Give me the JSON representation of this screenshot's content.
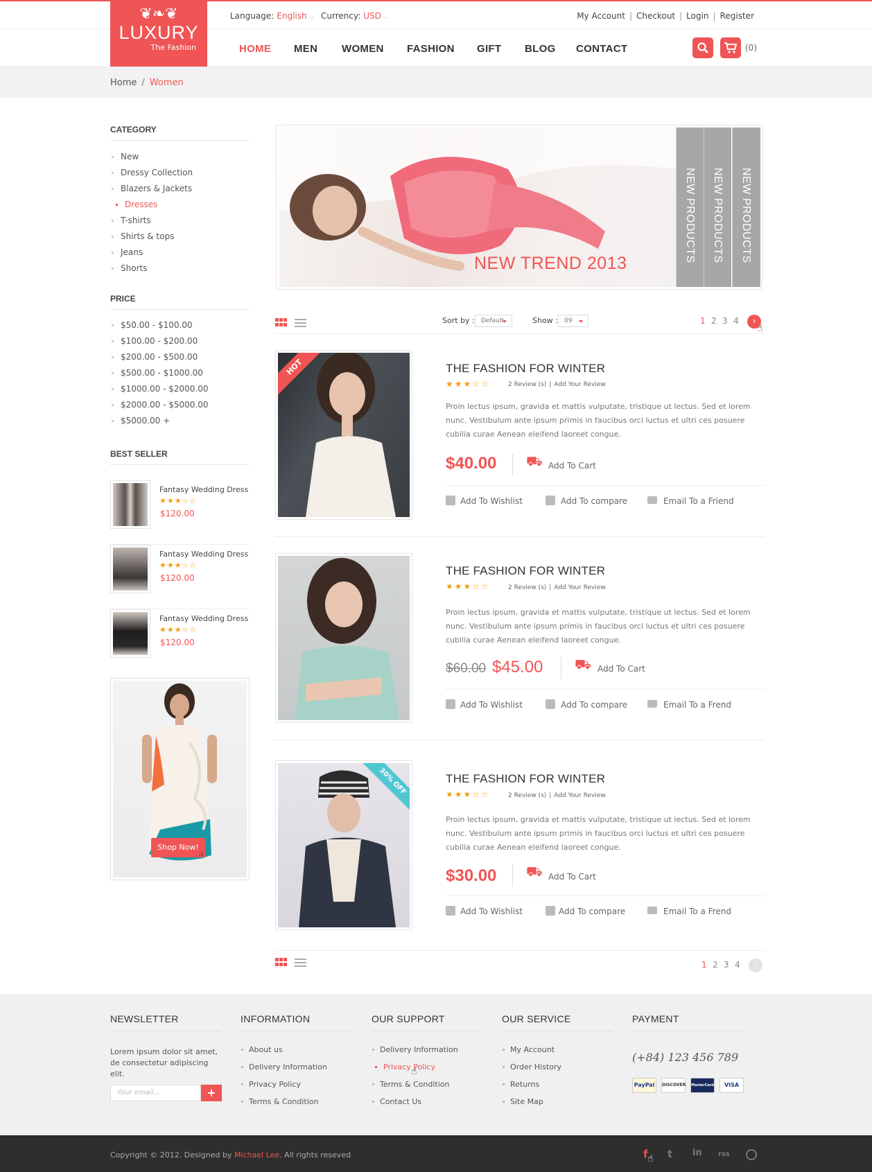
{
  "brand": {
    "ornament": "❦❧❦",
    "name": "LUXURY",
    "tagline": "The Fashion"
  },
  "topbar": {
    "language_label": "Language:",
    "language_value": "English",
    "currency_label": "Currency:",
    "currency_value": "USD",
    "links": [
      "My Account",
      "Checkout",
      "Login",
      "Register"
    ]
  },
  "nav": {
    "items": [
      "HOME",
      "MEN",
      "WOMEN",
      "FASHION",
      "GIFT",
      "BLOG",
      "CONTACT"
    ],
    "active": "HOME",
    "cart_count": "(0)"
  },
  "breadcrumb": {
    "home": "Home",
    "current": "Women"
  },
  "sidebar": {
    "category_title": "CATEGORY",
    "categories": [
      "New",
      "Dressy Collection",
      "Blazers & Jackets",
      "Dresses",
      "T-shirts",
      "Shirts & tops",
      "Jeans",
      "Shorts"
    ],
    "active_category": "Dresses",
    "price_title": "PRICE",
    "prices": [
      "$50.00 - $100.00",
      "$100.00 - $200.00",
      "$200.00 - $500.00",
      "$500.00 - $1000.00",
      "$1000.00 - $2000.00",
      "$2000.00 - $5000.00",
      "$5000.00 +"
    ],
    "bestseller_title": "BEST SELLER",
    "bestsellers": [
      {
        "name": "Fantasy Wedding Dress",
        "rating": 3,
        "price": "$120.00"
      },
      {
        "name": "Fantasy Wedding Dress",
        "rating": 3,
        "price": "$120.00"
      },
      {
        "name": "Fantasy Wedding Dress",
        "rating": 3,
        "price": "$120.00"
      }
    ],
    "promo_button": "Shop Now!"
  },
  "banner": {
    "headline": "NEW TREND  2013",
    "tabs": [
      "NEW PRODUCTS",
      "NEW PRODUCTS",
      "NEW PRODUCTS"
    ]
  },
  "toolbar": {
    "sort_label": "Sort by :",
    "sort_value": "Default",
    "show_label": "Show :",
    "show_value": "09",
    "pages": [
      "1",
      "2",
      "3",
      "4"
    ],
    "current_page": "1",
    "next_icon": "›"
  },
  "stars": {
    "full": "★",
    "empty": "☆"
  },
  "products": [
    {
      "badge": "HOT",
      "title": "THE FASHION FOR WINTER",
      "rating": 3,
      "reviews": "2 Review (s)",
      "add_review": "Add Your Review",
      "description": "Proin lectus ipsum, gravida et mattis vulputate, tristique ut lectus. Sed et lorem nunc. Vestibulum ante ipsum primis in faucibus orci luctus et ultri ces posuere cubilia curae Aenean eleifend laoreet congue.",
      "price": "$40.00",
      "old_price": "",
      "add_to_cart": "Add To Cart",
      "wishlist": "Add To Wishlist",
      "compare": "Add To compare",
      "email": "Email To a Friend"
    },
    {
      "badge": "",
      "title": "THE FASHION FOR WINTER",
      "rating": 3,
      "reviews": "2 Review (s)",
      "add_review": "Add Your Review",
      "description": "Proin lectus ipsum, gravida et mattis vulputate, tristique ut lectus. Sed et lorem nunc. Vestibulum ante ipsum primis in faucibus orci luctus et ultri ces posuere cubilia curae Aenean eleifend laoreet congue.",
      "price": "$45.00",
      "old_price": "$60.00",
      "add_to_cart": "Add To Cart",
      "wishlist": "Add To Wishlist",
      "compare": "Add To compare",
      "email": "Email To a Frend"
    },
    {
      "badge": "30% OFF",
      "title": "THE FASHION FOR WINTER",
      "rating": 3,
      "reviews": "2 Review (s)",
      "add_review": "Add Your Review",
      "description": "Proin lectus ipsum, gravida et mattis vulputate, tristique ut lectus. Sed et lorem nunc. Vestibulum ante ipsum primis in faucibus orci luctus et ultri ces posuere cubilia curae Aenean eleifend laoreet congue.",
      "price": "$30.00",
      "old_price": "",
      "add_to_cart": "Add To Cart",
      "wishlist": "Add To Wishlist",
      "compare": "Add To compare",
      "email": "Email To a Frend"
    }
  ],
  "footer": {
    "newsletter": {
      "title": "NEWSLETTER",
      "text": "Lorem ipsum dolor sit amet, de consectetur adipiscing elit.",
      "placeholder": "Your email...",
      "button": "+"
    },
    "information": {
      "title": "INFORMATION",
      "items": [
        "About us",
        "Delivery Information",
        "Privacy Policy",
        "Terms & Condition"
      ]
    },
    "support": {
      "title": "OUR SUPPORT",
      "items": [
        "Delivery Information",
        "Privacy Policy",
        "Terms & Condition",
        "Contact Us"
      ],
      "active": "Privacy Policy"
    },
    "service": {
      "title": "OUR SERVICE",
      "items": [
        "My Account",
        "Order History",
        "Returns",
        "Site Map"
      ]
    },
    "payment": {
      "title": "PAYMENT",
      "phone": "(+84) 123 456 789",
      "cards": [
        "PayPal",
        "DISCOVER",
        "MasterCard",
        "VISA"
      ]
    }
  },
  "bottom": {
    "copyright_prefix": "Copyright © 2012. Designed by ",
    "designer": "Michael Lee",
    "copyright_suffix": ". All rights reseved",
    "social_icons": [
      "f",
      "t",
      "in",
      "rss",
      "dribbble"
    ]
  },
  "colors": {
    "accent": "#f05454",
    "star": "#f39c12",
    "footer_bg": "#f0f0f0",
    "bottom_bg": "#2e2e2e",
    "badge_teal": "#4fc7d3"
  }
}
